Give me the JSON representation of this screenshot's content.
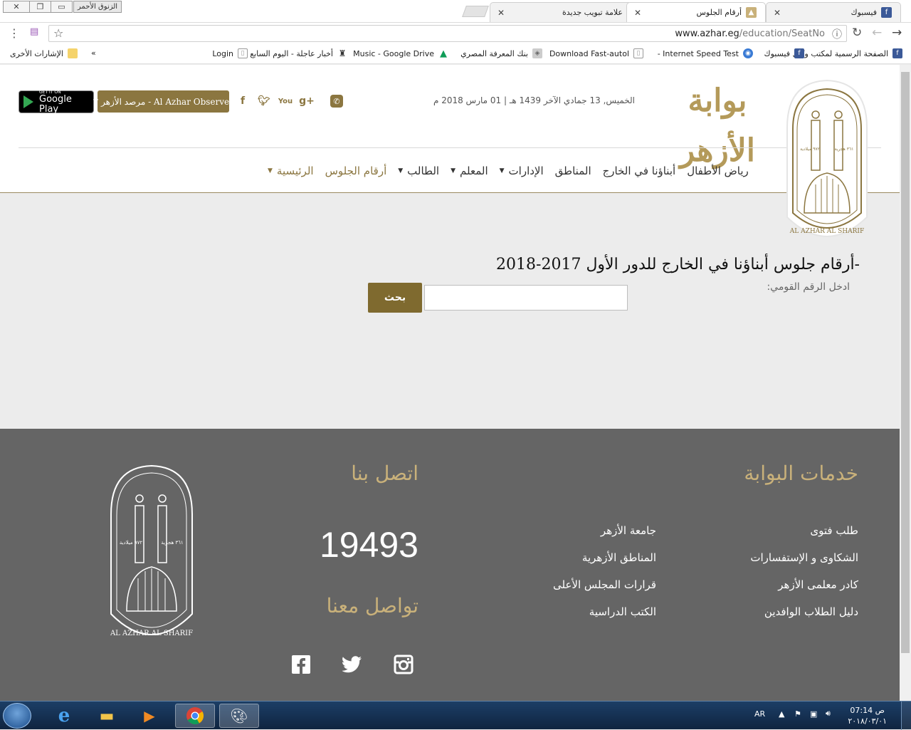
{
  "browser": {
    "window_controls": {
      "close": "✕",
      "restore": "❐",
      "minimize": "▭"
    },
    "profile_label": "الزنوق الأحمر",
    "tabs": [
      {
        "title": "فيسبوك",
        "icon": "facebook-icon",
        "active": false
      },
      {
        "title": "أرقام الجلوس",
        "icon": "azhar-favicon",
        "active": true
      },
      {
        "title": "علامة تبويب جديدة",
        "icon": "",
        "active": false
      }
    ],
    "url_main": "www.azhar.eg",
    "url_path": "/education/SeatNo",
    "bookmarks": [
      {
        "label": "الصفحة الرسمية لمكتب وكيل",
        "icon": "facebook-icon",
        "color": "#3b5998"
      },
      {
        "label": "فيسبوك",
        "icon": "facebook-icon",
        "color": "#3b5998"
      },
      {
        "label": "Internet Speed Test -",
        "icon": "globe-icon",
        "color": "#3a7bd5"
      },
      {
        "label": "Download Fast-autol",
        "icon": "page-icon",
        "color": "#999999"
      },
      {
        "label": "بنك المعرفة المصري",
        "icon": "ekb-icon",
        "color": "#888888"
      },
      {
        "label": "Music - Google Drive",
        "icon": "drive-icon",
        "color": "#0f9d58"
      },
      {
        "label": "أخبار عاجلة - اليوم السابع",
        "icon": "youm7-icon",
        "color": "#333333"
      },
      {
        "label": "Login",
        "icon": "page-icon",
        "color": "#999999"
      }
    ],
    "bookmarks_more": "»",
    "other_bookmarks": "الإشارات الأخرى"
  },
  "header": {
    "date_text": "الخميس, 13 جمادي الآخر 1439 هـ | 01 مارس 2018 م",
    "observer_label": "مرصد الأزهر - Al Azhar Observer",
    "google_play_small": "GET IT ON",
    "google_play_big": "Google Play",
    "wordmark": "بوابة الأزهر",
    "logo_text": "AL AZHAR AL SHARIF",
    "logo_hijri": "٣٦١ هجرية",
    "logo_greg": "٩٧٢ ميلادية"
  },
  "nav": {
    "items": [
      {
        "label": "الرئيسية",
        "caret": true,
        "gold": true
      },
      {
        "label": "أرقام الجلوس",
        "caret": false,
        "gold": true
      },
      {
        "label": "الطالب",
        "caret": true,
        "gold": false
      },
      {
        "label": "المعلم",
        "caret": true,
        "gold": false
      },
      {
        "label": "الإدارات",
        "caret": true,
        "gold": false
      },
      {
        "label": "المناطق",
        "caret": false,
        "gold": false
      },
      {
        "label": "أبناؤنا في الخارج",
        "caret": false,
        "gold": false
      },
      {
        "label": "رياض الأطفال",
        "caret": false,
        "gold": false
      }
    ]
  },
  "search": {
    "title": "-أرقام جلوس أبناؤنا في الخارج للدور الأول 2017-2018",
    "label": "ادخل الرقم القومي:",
    "input_value": "",
    "button_label": "بحث"
  },
  "footer": {
    "services_title": "خدمات البوابة",
    "services_col1": [
      "طلب فتوى",
      "الشكاوى و الإستفسارات",
      "كادر معلمى الأزهر",
      "دليل الطلاب الوافدين"
    ],
    "services_col2": [
      "جامعة الأزهر",
      "المناطق الأزهرية",
      "قرارات المجلس الأعلى",
      "الكتب الدراسية"
    ],
    "contact_title": "اتصل بنا",
    "hotline": "19493",
    "social_title": "تواصل معنا",
    "logo_text": "AL AZHAR AL SHARIF",
    "logo_hijri": "٣٦١ هجرية",
    "logo_greg": "٩٧٢ ميلادية"
  },
  "taskbar": {
    "lang": "AR",
    "time": "07:14 ص",
    "date": "٢٠١٨/٠٣/٠١"
  },
  "colors": {
    "gold": "#8b7640",
    "gold_light": "#c9b17a",
    "footer_bg": "#656565",
    "page_bg": "#ececec"
  }
}
